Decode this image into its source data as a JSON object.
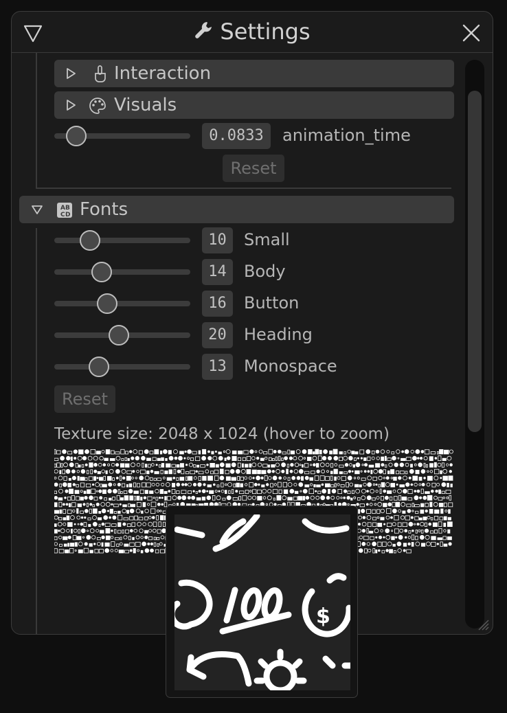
{
  "window": {
    "title": "Settings",
    "title_icon": "wrench-icon",
    "collapse_icon": "triangle-down-icon",
    "close_icon": "close-icon"
  },
  "sections": {
    "interaction": {
      "label": "Interaction",
      "icon": "pointing-hand-icon",
      "expanded": false
    },
    "visuals": {
      "label": "Visuals",
      "icon": "palette-icon",
      "expanded": false
    },
    "animation": {
      "value": "0.0833",
      "label": "animation_time",
      "fraction": 0.1,
      "reset_label": "Reset"
    },
    "fonts": {
      "label": "Fonts",
      "icon": "font-abcd-icon",
      "expanded": true,
      "sliders": [
        {
          "value": "10",
          "label": "Small",
          "fraction": 0.22
        },
        {
          "value": "14",
          "label": "Body",
          "fraction": 0.32
        },
        {
          "value": "16",
          "label": "Button",
          "fraction": 0.37
        },
        {
          "value": "20",
          "label": "Heading",
          "fraction": 0.47
        },
        {
          "value": "13",
          "label": "Monospace",
          "fraction": 0.3
        }
      ],
      "reset_label": "Reset",
      "texture_label": "Texture size: 2048 x 1024 (hover to zoom)"
    }
  },
  "scrollbar": {
    "position": 0.16,
    "visible_fraction": 0.6
  },
  "colors": {
    "window_bg": "#1b1b1b",
    "header_bg": "#3a3a3a",
    "text": "#bcbcbc",
    "track": "#3c3c3c",
    "knob_border": "#bdbdbd"
  }
}
